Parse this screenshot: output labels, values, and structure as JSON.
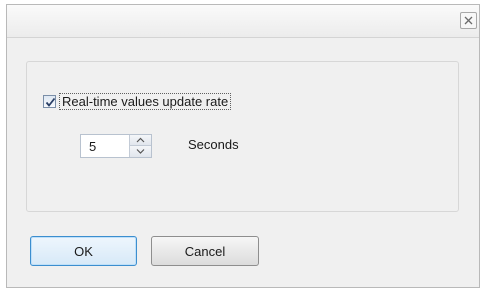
{
  "dialog": {
    "close_icon": "close-icon",
    "checkbox": {
      "label": "Real-time values update rate",
      "checked": true
    },
    "stepper": {
      "value": "5",
      "unit_label": "Seconds"
    },
    "buttons": {
      "ok_label": "OK",
      "cancel_label": "Cancel"
    },
    "colors": {
      "ok_border": "#3c8ecf",
      "dialog_bg": "#f0f0f0"
    }
  }
}
